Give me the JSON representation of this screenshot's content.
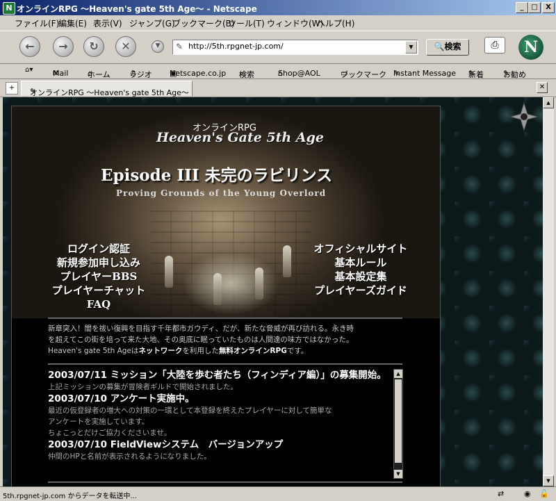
{
  "window": {
    "title": "オンラインRPG 〜Heaven's gate 5th Age〜 - Netscape",
    "app_icon": "N",
    "controls": [
      "_",
      "□",
      "X"
    ]
  },
  "menu": [
    "ファイル(F)",
    "編集(E)",
    "表示(V)",
    "ジャンプ(G)",
    "ブックマーク(B)",
    "ツール(T)",
    "ウィンドウ(W)",
    "ヘルプ(H)"
  ],
  "navigation": {
    "url": "http://5th.rpgnet-jp.com/",
    "search_label": "検索",
    "logo_letter": "N"
  },
  "bookmarks": [
    "Mail",
    "ホーム",
    "ラジオ",
    "Netscape.co.jp",
    "検索",
    "Shop@AOL",
    "ブックマーク",
    "Instant Message",
    "新着",
    "お勧め"
  ],
  "tab": {
    "label": "オンラインRPG 〜Heaven's gate 5th Age〜"
  },
  "page": {
    "sub_title": "オンラインRPG",
    "logo": "Heaven's Gate 5th Age",
    "episode": "Episode III 未完のラビリンス",
    "subtitle_en": "Proving Grounds of the Young Overlord",
    "menu_left": [
      "ログイン認証",
      "新規参加申し込み",
      "プレイヤーBBS",
      "プレイヤーチャット",
      "FAQ"
    ],
    "menu_right": [
      "オフィシャルサイト",
      "基本ルール",
      "基本設定集",
      "プレイヤーズガイド"
    ],
    "intro": {
      "line1": "新章突入！闇を祓い復興を目指す千年都市ガウディ、だが、新たな脅威が再び訪れる。永き時",
      "line2": "を超えてこの街を培って来た大地、その奥底に眠っていたものは人間達の味方ではなかった。",
      "line3_pre": "Heaven's gate 5th Ageは",
      "line3_bold1": "ネットワーク",
      "line3_mid": "を利用した",
      "line3_bold2": "無料オンラインRPG",
      "line3_post": "です。"
    },
    "news": [
      {
        "headline": "2003/07/11 ミッション「大陸を歩む者たち（フィンディア編）」の募集開始。",
        "body": [
          "上記ミッションの募集が冒険者ギルドで開始されました。"
        ]
      },
      {
        "headline": "2003/07/10 アンケート実施中。",
        "body": [
          "最近の仮登録者の増大への対策の一環として本登録を終えたプレイヤーに対して簡単な",
          "アンケートを実施しています。",
          "ちょこっとだけご協力くださいませ。"
        ]
      },
      {
        "headline": "2003/07/10 FieldViewシステム　バージョンアップ",
        "body": [
          "仲間のHPと名前が表示されるようになりました。"
        ]
      }
    ]
  },
  "status": {
    "text": "5th.rpgnet-jp.com からデータを転送中..."
  }
}
